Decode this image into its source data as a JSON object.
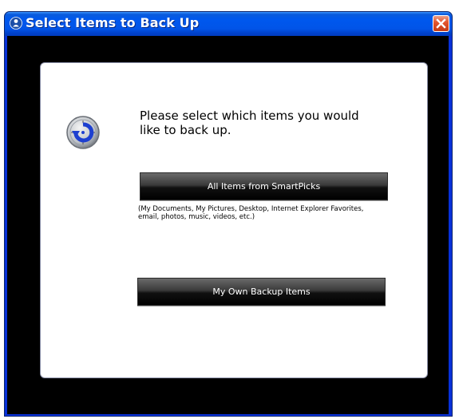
{
  "window": {
    "title": "Select Items to Back Up"
  },
  "dialog": {
    "prompt": "Please select which items you would like to back up.",
    "all_items_button": "All Items from SmartPicks",
    "all_items_note": "(My Documents, My Pictures, Desktop, Internet Explorer Favorites, email, photos, music, videos, etc.)",
    "own_items_button": "My Own Backup Items"
  },
  "icons": {
    "title_icon": "app-person-icon",
    "close_icon": "close-x-icon",
    "backup_icon": "backup-clock-arrow-icon"
  },
  "colors": {
    "titlebar": "#0054e3",
    "close_button": "#e3562f",
    "client_background": "#000000",
    "panel_background": "#ffffff",
    "button_background": "#1a1a1a"
  }
}
